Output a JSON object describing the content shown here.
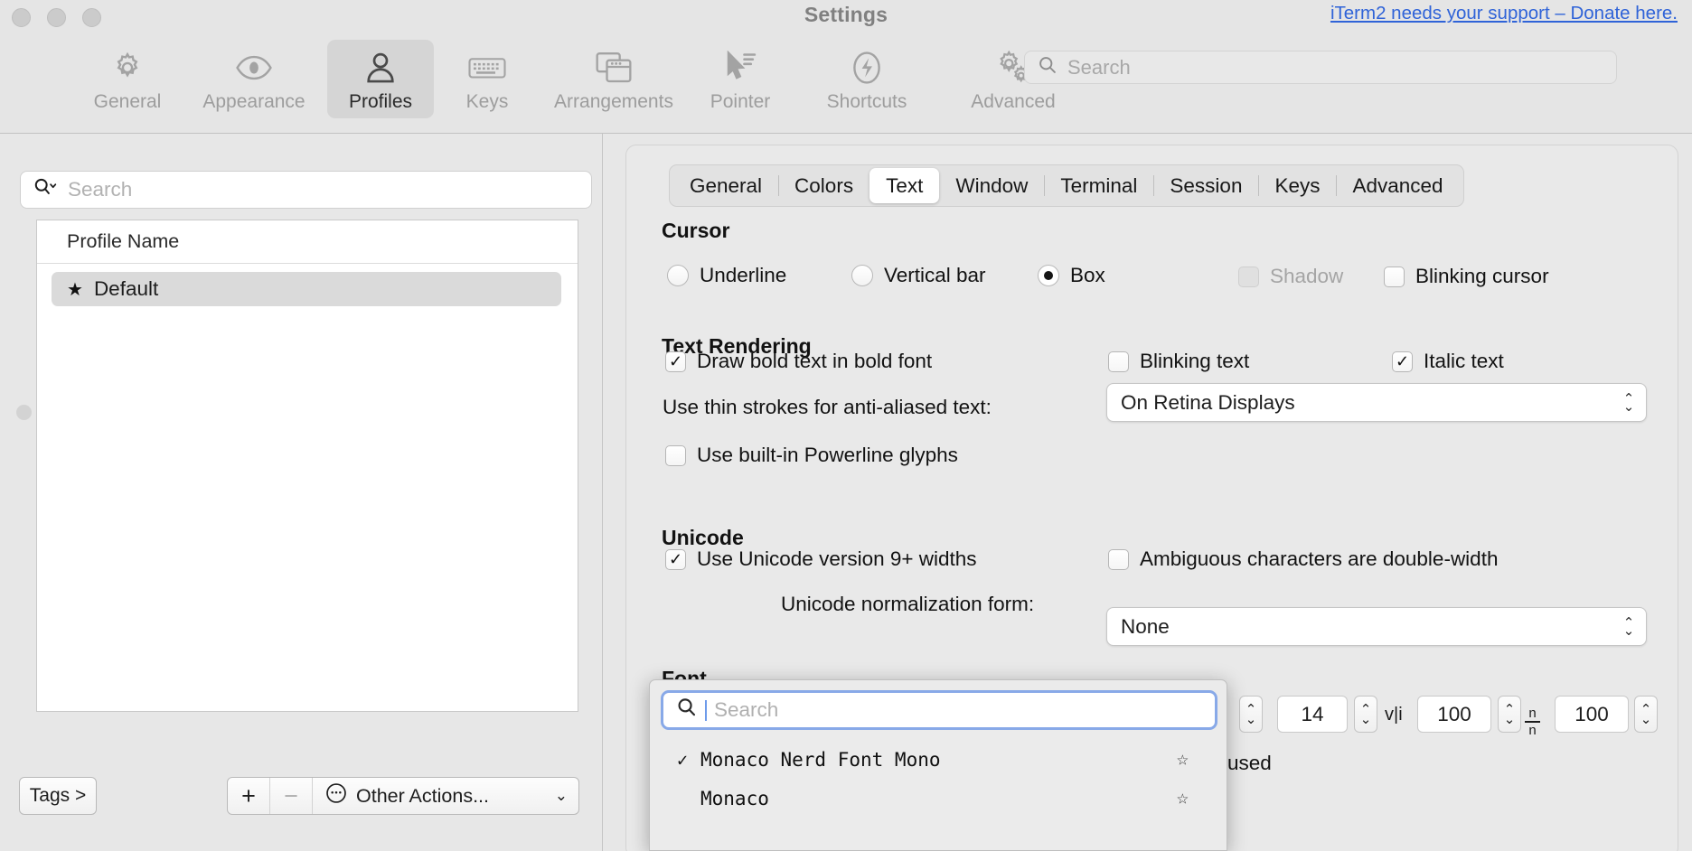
{
  "window": {
    "title": "Settings",
    "donate_link": "iTerm2 needs your support – Donate here."
  },
  "toolbar": {
    "tabs": [
      {
        "label": "General",
        "icon": "gear-icon"
      },
      {
        "label": "Appearance",
        "icon": "eye-icon"
      },
      {
        "label": "Profiles",
        "icon": "person-icon"
      },
      {
        "label": "Keys",
        "icon": "keyboard-icon"
      },
      {
        "label": "Arrangements",
        "icon": "windows-icon"
      },
      {
        "label": "Pointer",
        "icon": "cursor-icon"
      },
      {
        "label": "Shortcuts",
        "icon": "bolt-icon"
      },
      {
        "label": "Advanced",
        "icon": "gears-icon"
      }
    ],
    "selected": "Profiles",
    "search_placeholder": "Search",
    "search_value": "",
    "search_icon": "search-icon"
  },
  "sidebar": {
    "search_placeholder": "Search",
    "search_value": "",
    "search_icon": "search-dropdown-icon",
    "table_header": "Profile Name",
    "profiles": [
      {
        "name": "Default",
        "is_default": true,
        "selected": true,
        "star_icon": "star-filled-icon"
      }
    ],
    "tags_button": "Tags >",
    "add_button": "+",
    "remove_button": "−",
    "other_actions": "Other Actions...",
    "other_actions_icon": "ellipsis-circle-icon",
    "other_actions_chevron": "chevron-down-icon"
  },
  "profile_tabs": {
    "items": [
      "General",
      "Colors",
      "Text",
      "Window",
      "Terminal",
      "Session",
      "Keys",
      "Advanced"
    ],
    "selected": "Text"
  },
  "text_pane": {
    "cursor": {
      "title": "Cursor",
      "options": [
        {
          "label": "Underline",
          "selected": false
        },
        {
          "label": "Vertical bar",
          "selected": false
        },
        {
          "label": "Box",
          "selected": true
        }
      ],
      "shadow": {
        "label": "Shadow",
        "checked": false,
        "disabled": true
      },
      "blinking_cursor": {
        "label": "Blinking cursor",
        "checked": false,
        "disabled": false
      }
    },
    "text_rendering": {
      "title": "Text Rendering",
      "draw_bold": {
        "label": "Draw bold text in bold font",
        "checked": true
      },
      "blinking_text": {
        "label": "Blinking text",
        "checked": false
      },
      "italic_text": {
        "label": "Italic text",
        "checked": true
      },
      "thin_strokes_label": "Use thin strokes for anti-aliased text:",
      "thin_strokes_value": "On Retina Displays",
      "powerline": {
        "label": "Use built-in Powerline glyphs",
        "checked": false
      }
    },
    "unicode": {
      "title": "Unicode",
      "version9": {
        "label": "Use Unicode version 9+ widths",
        "checked": true
      },
      "ambiguous": {
        "label": "Ambiguous characters are double-width",
        "checked": false
      },
      "normalization_label": "Unicode normalization form:",
      "normalization_value": "None"
    },
    "font": {
      "title": "Font",
      "size_value": "14",
      "horizontal_spacing_value": "100",
      "horizontal_spacing_icon": "horizontal-spacing-icon",
      "vertical_spacing_value": "100",
      "vertical_spacing_icon": "vertical-spacing-icon",
      "occluded_text": "used"
    }
  },
  "font_popup": {
    "search_placeholder": "Search",
    "search_value": "",
    "search_icon": "search-icon",
    "items": [
      {
        "name": "Monaco Nerd Font Mono",
        "checked": true,
        "check_icon": "checkmark-icon",
        "favorite_icon": "star-outline-icon"
      },
      {
        "name": "Monaco",
        "checked": false,
        "check_icon": "",
        "favorite_icon": "star-outline-icon"
      }
    ]
  },
  "colors": {
    "link": "#2f63d8",
    "window_bg": "#e7e7e7",
    "panel_bg": "#e9e9e9",
    "focus_ring": "#88a9e8",
    "selection": "#dadada"
  }
}
